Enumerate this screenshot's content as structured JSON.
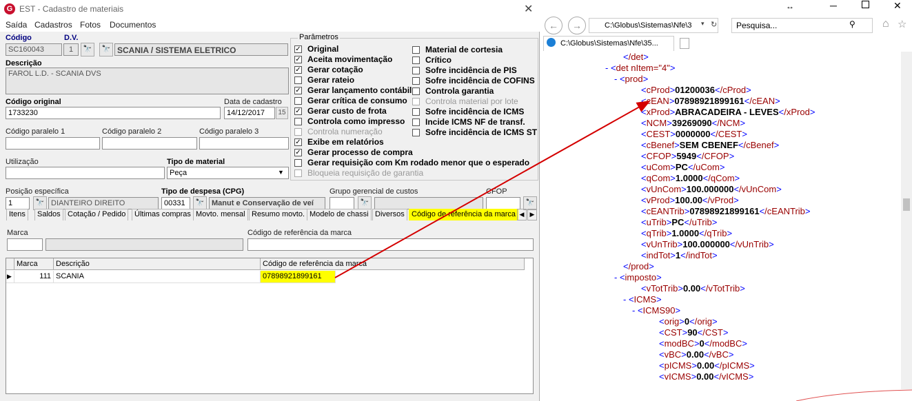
{
  "left": {
    "title": "EST - Cadastro de materiais",
    "logo": "G",
    "close": "✕",
    "menu": [
      "Saída",
      "Cadastros",
      "Fotos",
      "Documentos"
    ],
    "codigo": {
      "label": "Código",
      "value": "SC160043"
    },
    "dv": {
      "label": "D.V.",
      "value": "1"
    },
    "grupo": "SCANIA / SISTEMA ELETRICO",
    "descricao": {
      "label": "Descrição",
      "value": "FAROL L.D. - SCANIA DVS"
    },
    "codigo_original": {
      "label": "Código original",
      "value": "1733230"
    },
    "data_cadastro": {
      "label": "Data de cadastro",
      "value": "14/12/2017",
      "btn": "15"
    },
    "paralelo1": "Código paralelo 1",
    "paralelo2": "Código paralelo 2",
    "paralelo3": "Código paralelo 3",
    "utilizacao": "Utilização",
    "tipo_material": {
      "label": "Tipo de material",
      "value": "Peça"
    },
    "posicao": {
      "label": "Posição específica",
      "code": "1",
      "value": "DIANTEIRO DIREITO"
    },
    "despesa": {
      "label": "Tipo de despesa (CPG)",
      "code": "00331",
      "value": "Manut e Conservação de veí"
    },
    "grupo_gerencial": "Grupo gerencial de custos",
    "cfop": "CFOP",
    "params_title": "Parâmetros",
    "params_left": [
      {
        "label": "Original",
        "checked": true,
        "enabled": true
      },
      {
        "label": "Aceita movimentação",
        "checked": true,
        "enabled": true
      },
      {
        "label": "Gerar cotação",
        "checked": true,
        "enabled": true
      },
      {
        "label": "Gerar rateio",
        "checked": false,
        "enabled": true
      },
      {
        "label": "Gerar lançamento contábil",
        "checked": true,
        "enabled": true
      },
      {
        "label": "Gerar crítica de consumo",
        "checked": false,
        "enabled": true
      },
      {
        "label": "Gerar custo de frota",
        "checked": true,
        "enabled": true
      },
      {
        "label": "Controla como impresso",
        "checked": false,
        "enabled": true
      },
      {
        "label": "Controla numeração",
        "checked": false,
        "enabled": false
      },
      {
        "label": "Exibe em relatórios",
        "checked": true,
        "enabled": true
      },
      {
        "label": "Gerar processo de compra",
        "checked": true,
        "enabled": true
      },
      {
        "label": "Gerar requisição com Km rodado menor que o esperado",
        "checked": false,
        "enabled": true
      },
      {
        "label": "Bloqueia requisição de garantia",
        "checked": false,
        "enabled": false
      }
    ],
    "params_right": [
      {
        "label": "Material de cortesia",
        "checked": false,
        "enabled": true
      },
      {
        "label": "Crítico",
        "checked": false,
        "enabled": true
      },
      {
        "label": "Sofre incidência de PIS",
        "checked": false,
        "enabled": true
      },
      {
        "label": "Sofre incidência de COFINS",
        "checked": false,
        "enabled": true
      },
      {
        "label": "Controla garantia",
        "checked": false,
        "enabled": true
      },
      {
        "label": "Controla material por lote",
        "checked": false,
        "enabled": false
      },
      {
        "label": "Sofre incidência de ICMS",
        "checked": false,
        "enabled": true
      },
      {
        "label": "Incide ICMS NF de transf.",
        "checked": false,
        "enabled": true
      },
      {
        "label": "Sofre incidência de ICMS ST",
        "checked": false,
        "enabled": true
      }
    ],
    "tabs": [
      "Itens",
      "Saldos",
      "Cotação / Pedido",
      "Últimas compras",
      "Movto. mensal",
      "Resumo movto.",
      "Modelo de chassi",
      "Diversos",
      "Código de referência da marca"
    ],
    "marca_label": "Marca",
    "ref_label": "Código de referência da marca",
    "grid_headers": [
      "Marca",
      "Descrição",
      "Código de referência da marca"
    ],
    "grid_row": {
      "marca": "111",
      "descricao": "SCANIA",
      "ref": "07898921899161"
    }
  },
  "ie": {
    "address": "C:\\Globus\\Sistemas\\Nfe\\3",
    "search_placeholder": "Pesquisa...",
    "tab_title": "C:\\Globus\\Sistemas\\Nfe\\35...",
    "lines": [
      {
        "indent": 2,
        "dash": "",
        "open": "/det",
        "val": "",
        "close": "",
        "attr": ""
      },
      {
        "indent": 1,
        "dash": "-",
        "open": "det",
        "attr": " nItem=\"4\"",
        "val": "",
        "close": ""
      },
      {
        "indent": 2,
        "dash": "-",
        "open": "prod",
        "attr": "",
        "val": "",
        "close": ""
      },
      {
        "indent": 3,
        "dash": "",
        "open": "cProd",
        "val": "01200036",
        "close": "/cProd",
        "attr": ""
      },
      {
        "indent": 3,
        "dash": "",
        "open": "cEAN",
        "val": "07898921899161",
        "close": "/cEAN",
        "attr": ""
      },
      {
        "indent": 3,
        "dash": "",
        "open": "xProd",
        "val": "ABRACADEIRA - LEVES",
        "close": "/xProd",
        "attr": ""
      },
      {
        "indent": 3,
        "dash": "",
        "open": "NCM",
        "val": "39269090",
        "close": "/NCM",
        "attr": ""
      },
      {
        "indent": 3,
        "dash": "",
        "open": "CEST",
        "val": "0000000",
        "close": "/CEST",
        "attr": ""
      },
      {
        "indent": 3,
        "dash": "",
        "open": "cBenef",
        "val": "SEM CBENEF",
        "close": "/cBenef",
        "attr": ""
      },
      {
        "indent": 3,
        "dash": "",
        "open": "CFOP",
        "val": "5949",
        "close": "/CFOP",
        "attr": ""
      },
      {
        "indent": 3,
        "dash": "",
        "open": "uCom",
        "val": "PC",
        "close": "/uCom",
        "attr": ""
      },
      {
        "indent": 3,
        "dash": "",
        "open": "qCom",
        "val": "1.0000",
        "close": "/qCom",
        "attr": ""
      },
      {
        "indent": 3,
        "dash": "",
        "open": "vUnCom",
        "val": "100.000000",
        "close": "/vUnCom",
        "attr": ""
      },
      {
        "indent": 3,
        "dash": "",
        "open": "vProd",
        "val": "100.00",
        "close": "/vProd",
        "attr": ""
      },
      {
        "indent": 3,
        "dash": "",
        "open": "cEANTrib",
        "val": "07898921899161",
        "close": "/cEANTrib",
        "attr": ""
      },
      {
        "indent": 3,
        "dash": "",
        "open": "uTrib",
        "val": "PC",
        "close": "/uTrib",
        "attr": ""
      },
      {
        "indent": 3,
        "dash": "",
        "open": "qTrib",
        "val": "1.0000",
        "close": "/qTrib",
        "attr": ""
      },
      {
        "indent": 3,
        "dash": "",
        "open": "vUnTrib",
        "val": "100.000000",
        "close": "/vUnTrib",
        "attr": ""
      },
      {
        "indent": 3,
        "dash": "",
        "open": "indTot",
        "val": "1",
        "close": "/indTot",
        "attr": ""
      },
      {
        "indent": 2,
        "dash": "",
        "open": "/prod",
        "val": "",
        "close": "",
        "attr": ""
      },
      {
        "indent": 2,
        "dash": "-",
        "open": "imposto",
        "attr": "",
        "val": "",
        "close": ""
      },
      {
        "indent": 3,
        "dash": "",
        "open": "vTotTrib",
        "val": "0.00",
        "close": "/vTotTrib",
        "attr": ""
      },
      {
        "indent": 3,
        "dash": "-",
        "open": "ICMS",
        "attr": "",
        "val": "",
        "close": ""
      },
      {
        "indent": 4,
        "dash": "-",
        "open": "ICMS90",
        "attr": "",
        "val": "",
        "close": ""
      },
      {
        "indent": 5,
        "dash": "",
        "open": "orig",
        "val": "0",
        "close": "/orig",
        "attr": ""
      },
      {
        "indent": 5,
        "dash": "",
        "open": "CST",
        "val": "90",
        "close": "/CST",
        "attr": ""
      },
      {
        "indent": 5,
        "dash": "",
        "open": "modBC",
        "val": "0",
        "close": "/modBC",
        "attr": ""
      },
      {
        "indent": 5,
        "dash": "",
        "open": "vBC",
        "val": "0.00",
        "close": "/vBC",
        "attr": ""
      },
      {
        "indent": 5,
        "dash": "",
        "open": "pICMS",
        "val": "0.00",
        "close": "/pICMS",
        "attr": ""
      },
      {
        "indent": 5,
        "dash": "",
        "open": "vICMS",
        "val": "0.00",
        "close": "/vICMS",
        "attr": ""
      }
    ]
  },
  "colors": {
    "highlight": "#ffff00",
    "arrow": "#d40000",
    "tag": "#990000",
    "markup": "#0000ff"
  }
}
